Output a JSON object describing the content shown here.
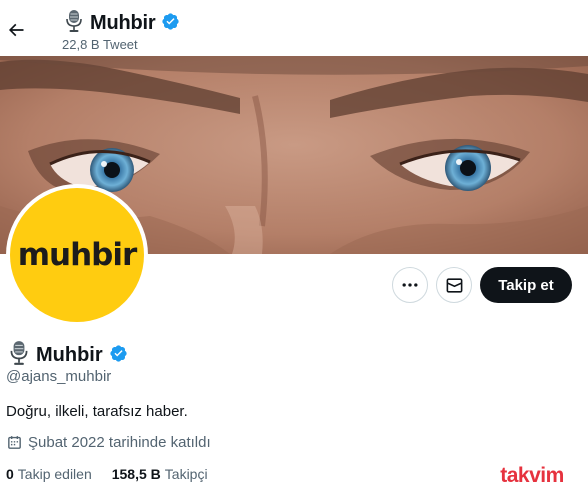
{
  "header": {
    "title": "Muhbir",
    "tweet_count": "22,8 B Tweet"
  },
  "profile": {
    "avatar_text": "muhbir",
    "display_name": "Muhbir",
    "handle": "@ajans_muhbir",
    "bio": "Doğru, ilkeli, tarafsız haber.",
    "joined": "Şubat 2022 tarihinde katıldı",
    "following_count": "0",
    "following_label": "Takip edilen",
    "followers_count": "158,5 B",
    "followers_label": "Takipçi"
  },
  "actions": {
    "follow_label": "Takip et"
  },
  "icons": [
    "back-arrow-icon",
    "microphone-icon",
    "verified-badge-icon",
    "more-icon",
    "mail-icon",
    "calendar-icon"
  ],
  "colors": {
    "verified": "#1d9bf0",
    "avatar_bg": "#ffcc10",
    "follow_button": "#0f1419",
    "secondary_text": "#536471",
    "watermark": "#e6323e"
  },
  "watermark": {
    "text": "takvim"
  }
}
